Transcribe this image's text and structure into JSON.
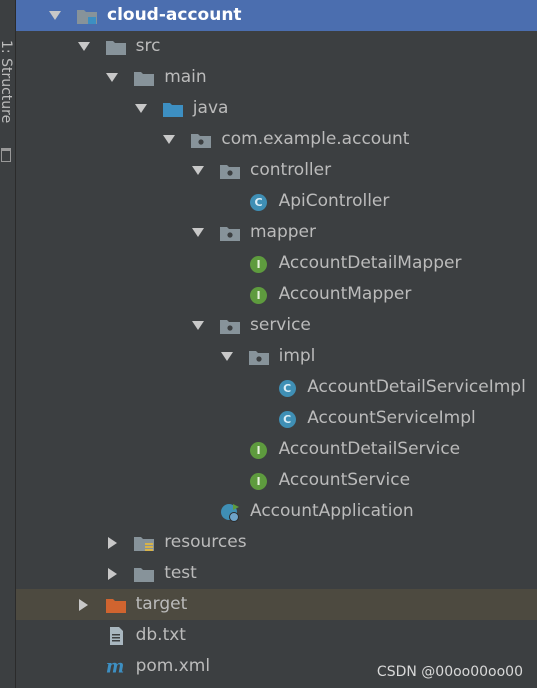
{
  "side_panel": {
    "label": "1: Structure"
  },
  "tree": [
    {
      "label": "cloud-account",
      "icon": "module-folder-icon",
      "arrow": "expanded",
      "selected": true,
      "name": "tree-item-cloud-account"
    },
    {
      "label": "src",
      "icon": "folder-icon",
      "arrow": "expanded",
      "name": "tree-item-src"
    },
    {
      "label": "main",
      "icon": "folder-icon",
      "arrow": "expanded",
      "name": "tree-item-main"
    },
    {
      "label": "java",
      "icon": "source-folder-icon",
      "arrow": "expanded",
      "name": "tree-item-java"
    },
    {
      "label": "com.example.account",
      "icon": "package-icon",
      "arrow": "expanded",
      "name": "tree-item-com-example-account"
    },
    {
      "label": "controller",
      "icon": "package-icon",
      "arrow": "expanded",
      "name": "tree-item-controller"
    },
    {
      "label": "ApiController",
      "icon": "class-icon",
      "badge": "C",
      "name": "tree-item-apicontroller"
    },
    {
      "label": "mapper",
      "icon": "package-icon",
      "arrow": "expanded",
      "name": "tree-item-mapper"
    },
    {
      "label": "AccountDetailMapper",
      "icon": "interface-icon",
      "badge": "I",
      "name": "tree-item-accountdetailmapper"
    },
    {
      "label": "AccountMapper",
      "icon": "interface-icon",
      "badge": "I",
      "name": "tree-item-accountmapper"
    },
    {
      "label": "service",
      "icon": "package-icon",
      "arrow": "expanded",
      "name": "tree-item-service"
    },
    {
      "label": "impl",
      "icon": "package-icon",
      "arrow": "expanded",
      "name": "tree-item-impl"
    },
    {
      "label": "AccountDetailServiceImpl",
      "icon": "class-icon",
      "badge": "C",
      "name": "tree-item-accountdetailserviceimpl"
    },
    {
      "label": "AccountServiceImpl",
      "icon": "class-icon",
      "badge": "C",
      "name": "tree-item-accountserviceimpl"
    },
    {
      "label": "AccountDetailService",
      "icon": "interface-icon",
      "badge": "I",
      "name": "tree-item-accountdetailservice"
    },
    {
      "label": "AccountService",
      "icon": "interface-icon",
      "badge": "I",
      "name": "tree-item-accountservice"
    },
    {
      "label": "AccountApplication",
      "icon": "spring-boot-app-icon",
      "name": "tree-item-accountapplication"
    },
    {
      "label": "resources",
      "icon": "resources-folder-icon",
      "arrow": "collapsed",
      "name": "tree-item-resources"
    },
    {
      "label": "test",
      "icon": "folder-icon",
      "arrow": "collapsed",
      "name": "tree-item-test"
    },
    {
      "label": "target",
      "icon": "excluded-folder-icon",
      "arrow": "collapsed",
      "excluded": true,
      "name": "tree-item-target"
    },
    {
      "label": "db.txt",
      "icon": "text-file-icon",
      "name": "tree-item-db-txt"
    },
    {
      "label": "pom.xml",
      "icon": "maven-icon",
      "name": "tree-item-pom-xml"
    }
  ],
  "watermark": "CSDN @00oo00oo00",
  "colors": {
    "background": "#3c3f41",
    "selection": "#4b6eaf",
    "excluded_row": "#4d4a40",
    "folder": "#87939a",
    "source_folder": "#3d8fc2",
    "excluded_folder": "#d0642f",
    "class_badge": "#3f8fb5",
    "interface_badge": "#5e9b3e",
    "text": "#bbbbbb"
  }
}
